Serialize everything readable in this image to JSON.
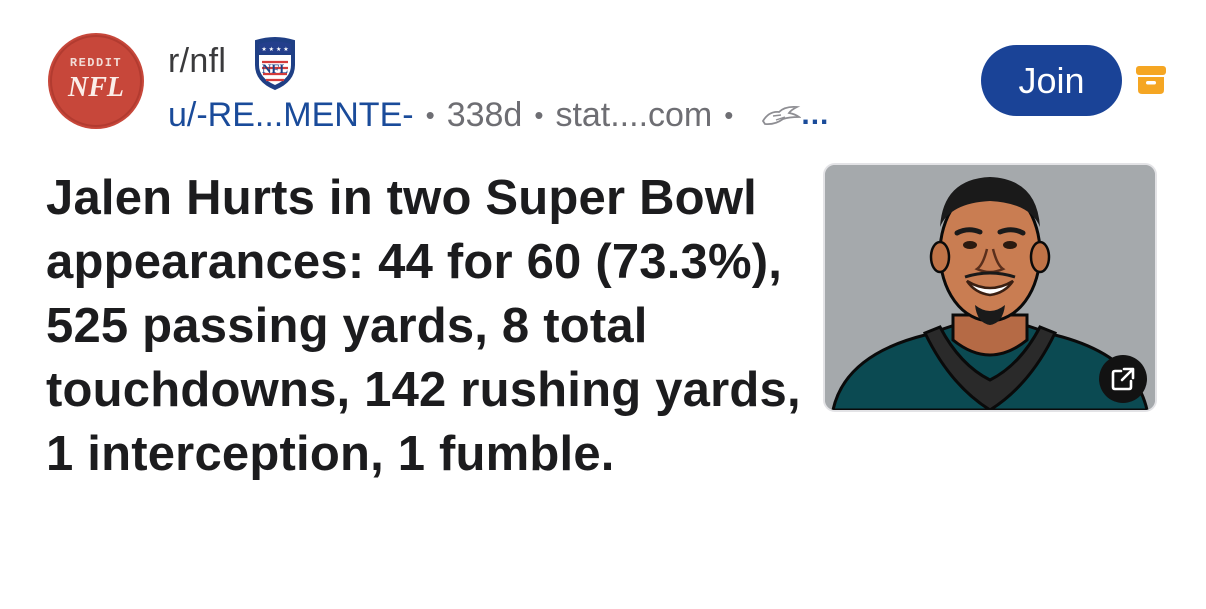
{
  "post": {
    "subreddit": "r/nfl",
    "author": "u/-RE...MENTE-",
    "age": "338d",
    "domain": "stat....com",
    "flair_more": "...",
    "title": "Jalen Hurts in two Super Bowl appearances: 44 for 60 (73.3%), 525 passing yards, 8 total touchdowns, 142 rushing yards, 1 interception, 1 fumble."
  },
  "avatar": {
    "line1": "REDDIT",
    "line2": "NFL"
  },
  "shield_text": "NFL",
  "actions": {
    "join_label": "Join"
  },
  "icons": {
    "avatar": "reddit-nfl-logo",
    "subreddit_badge": "nfl-shield-icon",
    "flair": "eagles-icon",
    "archive": "archive-icon",
    "external_link": "external-link-icon"
  },
  "colors": {
    "join_bg": "#1a4397",
    "author_link": "#1a4b9a",
    "avatar_bg": "#c7473a",
    "archive_icon": "#f5a623",
    "jersey": "#0b4a52"
  }
}
